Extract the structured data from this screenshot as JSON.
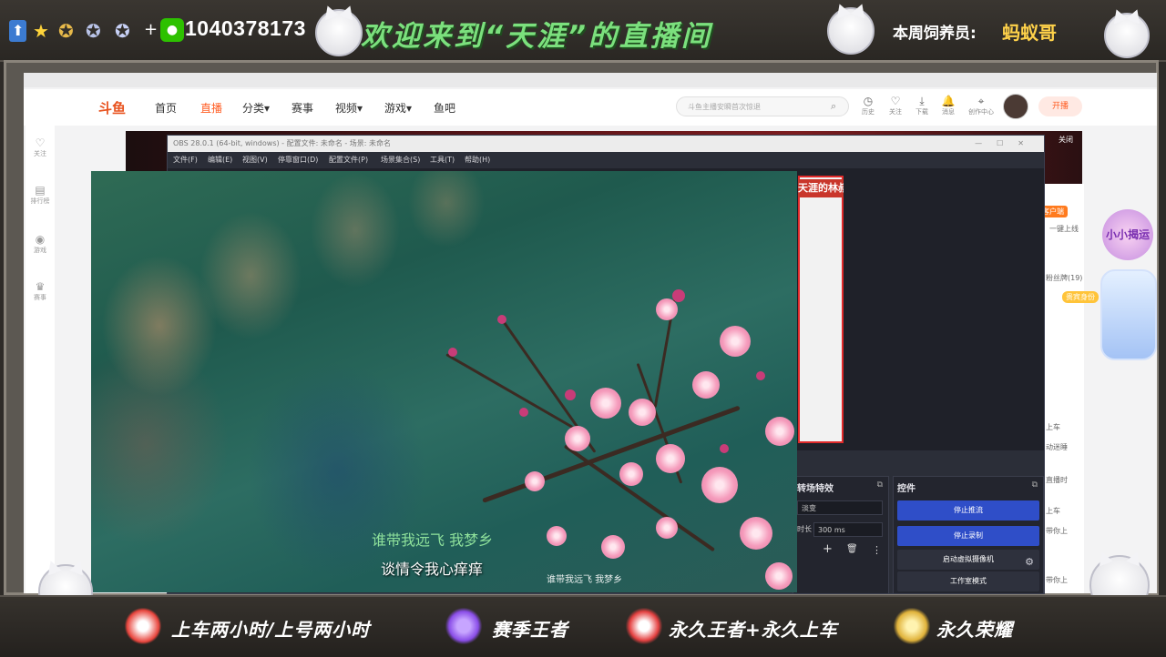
{
  "top_banner": {
    "wechat_id": "1040378173",
    "welcome": "欢迎来到“天涯”的直播间",
    "host_label": "本周饲养员:",
    "host_name": "蚂蚁哥"
  },
  "douyu": {
    "logo": "斗鱼",
    "nav": [
      "首页",
      "直播",
      "分类▾",
      "赛事",
      "视频▾",
      "游戏▾",
      "鱼吧"
    ],
    "search_placeholder": "斗鱼主播安瞬首次惊退",
    "tools": [
      {
        "icon": "history-icon",
        "glyph": "◷",
        "label": "历史"
      },
      {
        "icon": "follow-icon",
        "glyph": "♡",
        "label": "关注"
      },
      {
        "icon": "download-icon",
        "glyph": "⤓",
        "label": "下载"
      },
      {
        "icon": "message-icon",
        "glyph": "🔔",
        "label": "消息"
      },
      {
        "icon": "creator-icon",
        "glyph": "⌖",
        "label": "创作中心"
      }
    ],
    "start_stream": "开播",
    "rail": [
      {
        "icon": "heart-icon",
        "glyph": "♡",
        "label": "关注"
      },
      {
        "icon": "rank-icon",
        "glyph": "▤",
        "label": "排行榜"
      },
      {
        "icon": "game-icon",
        "glyph": "◉",
        "label": "游戏"
      },
      {
        "icon": "trophy-icon",
        "glyph": "♛",
        "label": "赛事"
      }
    ],
    "close_ad": "关闭",
    "client_pill": "客户端",
    "vip_pill": "贵宾身份",
    "right_texts": [
      "一键上线",
      "粉丝牌(19)",
      "上车",
      "动迷睡",
      "直播时",
      "上车",
      "带你上",
      "带你上"
    ],
    "promo": "小小揭运"
  },
  "obs": {
    "title": "OBS 28.0.1 (64-bit, windows) - 配置文件: 未命名 - 场景: 未命名",
    "menu": [
      "文件(F)",
      "编辑(E)",
      "视图(V)",
      "停靠窗口(D)",
      "配置文件(P)",
      "场景集合(S)",
      "工具(T)",
      "帮助(H)"
    ],
    "capture_title": "天涯的林叔",
    "transitions": {
      "title": "转场特效",
      "type": "淡变",
      "duration_label": "时长",
      "duration": "300 ms",
      "add": "+",
      "remove": "🗑",
      "more": "⋮"
    },
    "controls": {
      "title": "控件",
      "stop_stream": "停止推流",
      "stop_record": "停止录制",
      "virtual_cam": "启动虚拟摄像机",
      "studio_mode": "工作室模式"
    }
  },
  "video": {
    "lyric_1": "谁带我远飞 我梦乡",
    "lyric_2": "谈情令我心痒痒",
    "lyric_3": "谁带我远飞 我梦乡"
  },
  "bottom_banner": {
    "slogans": [
      "上车两小时/上号两小时",
      "赛季王者",
      "永久王者+永久上车",
      "永久荣耀"
    ]
  }
}
